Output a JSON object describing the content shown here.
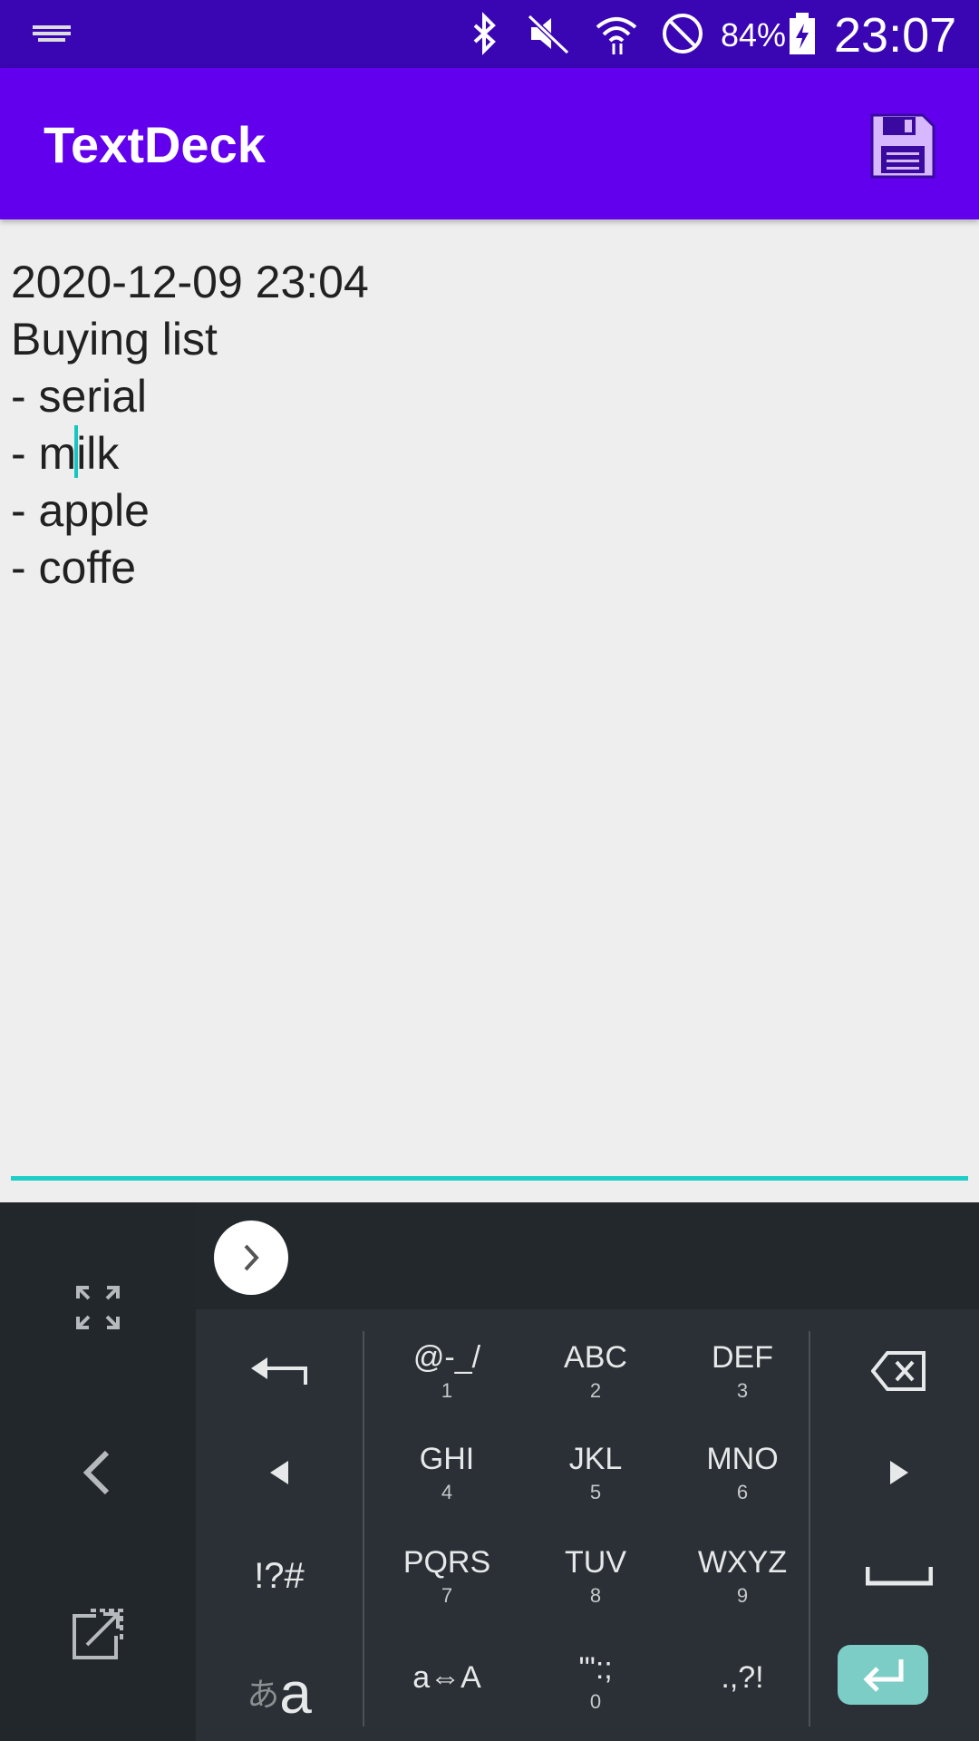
{
  "status_bar": {
    "battery_percent": "84%",
    "time": "23:07",
    "icons": [
      "keyboard-indicator-icon",
      "bluetooth-icon",
      "mute-icon",
      "wifi-icon",
      "do-not-disturb-icon",
      "battery-charging-icon"
    ]
  },
  "app_bar": {
    "title": "TextDeck",
    "action_icon": "save-icon"
  },
  "editor": {
    "lines": [
      "2020-12-09 23:04",
      "Buying list",
      "- serial",
      "- milk",
      "- apple",
      "- coffe"
    ],
    "cursor_line": 3,
    "cursor_before": "- m",
    "cursor_after": "ilk",
    "accent_color": "#1fcec6"
  },
  "keyboard": {
    "side_icons": [
      "fullscreen-icon",
      "back-chevron-icon",
      "popout-icon"
    ],
    "suggestion_icon": "chevron-right-icon",
    "rows": [
      [
        {
          "main": "@-_/",
          "sub": "1"
        },
        {
          "main": "ABC",
          "sub": "2"
        },
        {
          "main": "DEF",
          "sub": "3"
        }
      ],
      [
        {
          "main": "GHI",
          "sub": "4"
        },
        {
          "main": "JKL",
          "sub": "5"
        },
        {
          "main": "MNO",
          "sub": "6"
        }
      ],
      [
        {
          "main": "PQRS",
          "sub": "7"
        },
        {
          "main": "TUV",
          "sub": "8"
        },
        {
          "main": "WXYZ",
          "sub": "9"
        }
      ],
      [
        {
          "main": "a⇔A",
          "sub": ""
        },
        {
          "main": "'\":;",
          "sub": "0"
        },
        {
          "main": ".,?!",
          "sub": ""
        }
      ]
    ],
    "symbols_label": "!?#",
    "kana_label": "あ",
    "alpha_label": "a",
    "enter_color": "#7ccdc6"
  },
  "colors": {
    "status_bar": "#3a06b3",
    "app_bar": "#6200ee",
    "background": "#eeeeee"
  }
}
